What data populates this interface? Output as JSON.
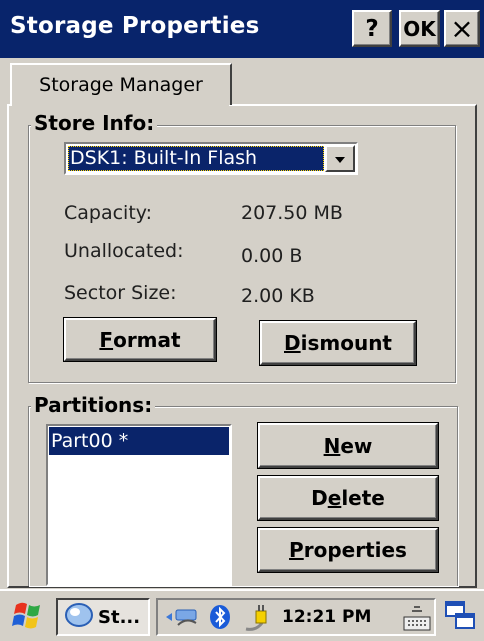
{
  "window": {
    "title": "Storage Properties",
    "help_label": "?",
    "ok_label": "OK",
    "close_label": "×"
  },
  "tabs": [
    {
      "label": "Storage Manager"
    }
  ],
  "store_info": {
    "legend": "Store Info:",
    "selected_store": "DSK1: Built-In Flash",
    "rows": [
      {
        "label": "Capacity:",
        "value": "207.50 MB"
      },
      {
        "label": "Unallocated:",
        "value": "0.00 B"
      },
      {
        "label": "Sector Size:",
        "value": "2.00 KB"
      }
    ],
    "format_button": {
      "mnemonic": "F",
      "rest": "ormat"
    },
    "dismount_button": {
      "mnemonic": "D",
      "rest": "ismount"
    }
  },
  "partitions": {
    "legend": "Partitions:",
    "items": [
      "Part00 *"
    ],
    "new_button": {
      "mnemonic": "N",
      "rest": "ew"
    },
    "delete_button": {
      "pre": "D",
      "mnemonic": "e",
      "rest": "lete"
    },
    "properties_button": {
      "mnemonic": "P",
      "rest": "roperties"
    }
  },
  "taskbar": {
    "task_label": "St...",
    "clock": "12:21 PM"
  },
  "icons": {
    "start": "windows-flag-icon",
    "task": "storage-manager-icon",
    "network": "network-icon",
    "bluetooth": "bluetooth-icon",
    "power": "power-plug-icon",
    "keyboard": "keyboard-icon",
    "desktop": "desktop-switch-icon"
  },
  "colors": {
    "titlebar": "#08246b",
    "selection": "#0a246a",
    "face": "#d4d0c8"
  }
}
